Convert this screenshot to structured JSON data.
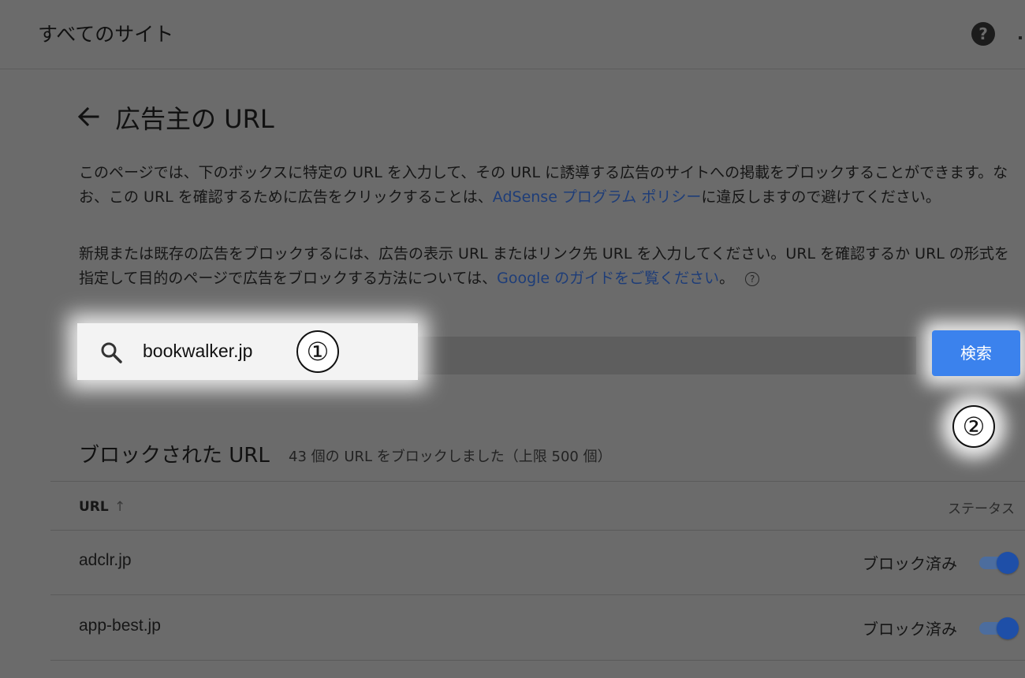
{
  "header": {
    "site_title": "すべてのサイト",
    "help_icon": "help-circle-icon"
  },
  "page": {
    "title": "広告主の URL",
    "back_icon": "arrow-left-icon"
  },
  "description": {
    "p1_before_link": "このページでは、下のボックスに特定の URL を入力して、その URL に誘導する広告のサイトへの掲載をブロックすることができます。なお、この URL を確認するために広告をクリックすることは、",
    "p1_link": "AdSense プログラム ポリシー",
    "p1_after_link": "に違反しますので避けてください。",
    "p2_before_link": "新規または既存の広告をブロックするには、広告の表示 URL またはリンク先 URL を入力してください。URL を確認するか URL の形式を指定して目的のページで広告をブロックする方法については、",
    "p2_link": "Google のガイドをご覧ください",
    "p2_after_link": "。",
    "hint_glyph": "?"
  },
  "search": {
    "value": "bookwalker.jp",
    "button_label": "検索",
    "annotation_1": "①",
    "annotation_2": "②"
  },
  "blocked": {
    "title": "ブロックされた URL",
    "count_text": "43 個の URL をブロックしました（上限 500 個）",
    "columns": {
      "url": "URL",
      "sort_glyph": "↑",
      "status": "ステータス"
    },
    "rows": [
      {
        "url": "adclr.jp",
        "status": "ブロック済み",
        "enabled": true
      },
      {
        "url": "app-best.jp",
        "status": "ブロック済み",
        "enabled": true
      }
    ]
  },
  "colors": {
    "overlay_bg": "#6b6b6b",
    "primary_button": "#3b82ed",
    "link": "#1e3d78",
    "toggle_on": "#1e4fa8"
  }
}
